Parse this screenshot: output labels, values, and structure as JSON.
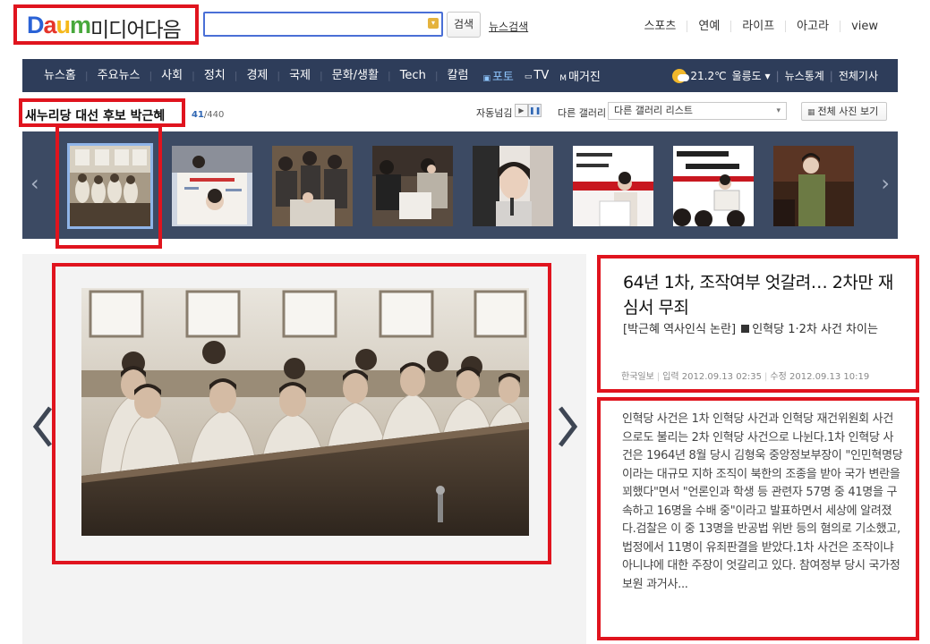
{
  "header": {
    "logo_letters": [
      "D",
      "a",
      "u",
      "m"
    ],
    "logo_colors": [
      "#2a62d6",
      "#e5352b",
      "#f5b81b",
      "#48a83c"
    ],
    "logo_text": "미디어다음",
    "search_placeholder": "",
    "search_button": "검색",
    "news_search": "뉴스검색",
    "top_links": [
      "스포츠",
      "연예",
      "라이프",
      "아고라",
      "view"
    ]
  },
  "nav": {
    "items": [
      "뉴스홈",
      "주요뉴스",
      "사회",
      "정치",
      "경제",
      "국제",
      "문화/생활",
      "Tech",
      "칼럼"
    ],
    "media": [
      {
        "icon": "▣",
        "label": "포토",
        "active": true
      },
      {
        "icon": "▭",
        "label": "TV",
        "active": false
      },
      {
        "icon": "M",
        "label": "매거진",
        "active": false
      }
    ],
    "weather": {
      "temp": "21.2℃",
      "region": "울릉도"
    },
    "right_links": [
      "뉴스통계",
      "전체기사"
    ]
  },
  "gallery": {
    "title": "새누리당 대선 후보 박근혜",
    "current": "41",
    "total": "/440",
    "autoplay_label": "자동넘김",
    "other_gallery_label": "다른 갤러리",
    "other_gallery_value": "다른 갤러리 리스트",
    "all_photos": "전체 사진 보기",
    "thumbnails": [
      {
        "name": "thumb-courtroom",
        "active": true
      },
      {
        "name": "thumb-signboard",
        "active": false
      },
      {
        "name": "thumb-crowd",
        "active": false
      },
      {
        "name": "thumb-signing",
        "active": false
      },
      {
        "name": "thumb-portrait",
        "active": false
      },
      {
        "name": "thumb-podium-1",
        "active": false
      },
      {
        "name": "thumb-podium-2",
        "active": false
      },
      {
        "name": "thumb-standing",
        "active": false
      }
    ]
  },
  "article": {
    "title": "64년 1차, 조작여부 엇갈려… 2차만 재심서 무죄",
    "subtitle_prefix": "[박근혜 역사인식 논란]",
    "subtitle_rest": "인혁당 1·2차 사건 차이는",
    "source": "한국일보",
    "input_time": "입력 2012.09.13 02:35",
    "edit_time": "수정 2012.09.13 10:19",
    "body": "인혁당 사건은 1차 인혁당 사건과 인혁당 재건위원회 사건으로도 불리는 2차 인혁당 사건으로 나뉜다.1차 인혁당 사건은 1964년 8월 당시 김형욱 중앙정보부장이 \"인민혁명당이라는 대규모 지하 조직이 북한의 조종을 받아 국가 변란을 꾀했다\"면서 \"언론인과 학생 등 관련자 57명 중 41명을 구속하고 16명을 수배 중\"이라고 발표하면서 세상에 알려졌다.검찰은 이 중 13명을 반공법 위반 등의 혐의로 기소했고, 법정에서 11명이 유죄판결을 받았다.1차 사건은 조작이냐 아니냐에 대한 주장이 엇갈리고 있다. 참여정부 당시 국가정보원 과거사..."
  },
  "colors": {
    "highlight": "#e0141e",
    "nav_bg": "#2e3d5a",
    "strip_bg": "#3c4a63"
  }
}
